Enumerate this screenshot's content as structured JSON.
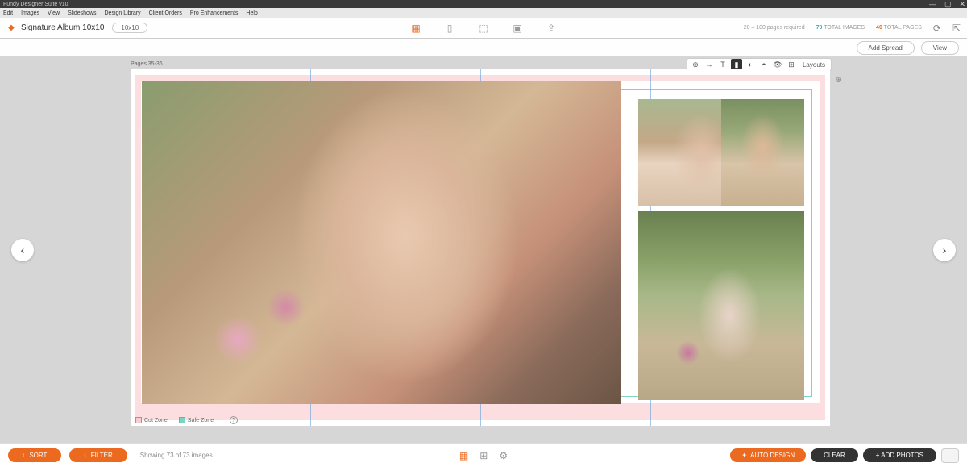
{
  "titlebar": {
    "app_name": "Fundy Designer Suite v10"
  },
  "window_controls": {
    "min": "—",
    "max": "▢",
    "close": "✕"
  },
  "menubar": {
    "items": [
      "Edit",
      "Images",
      "View",
      "Slideshows",
      "Design Library",
      "Client Orders",
      "Pro Enhancements",
      "Help"
    ]
  },
  "toolbar": {
    "album_title": "Signature Album 10x10",
    "size": "10x10",
    "pages_required": "~20 – 100 pages required",
    "total_images_count": "70",
    "total_images_label": "TOTAL IMAGES",
    "total_pages_count": "40",
    "total_pages_label": "TOTAL PAGES"
  },
  "subbar": {
    "add_spread": "Add Spread",
    "view": "View"
  },
  "workspace": {
    "pages_label": "Pages 35-36",
    "layouts_label": "Layouts",
    "legend_cut": "Cut Zone",
    "legend_safe": "Safe Zone"
  },
  "bottombar": {
    "sort": "SORT",
    "filter": "FILTER",
    "showing": "Showing 73 of 73 images",
    "auto_design": "AUTO DESIGN",
    "clear": "CLEAR",
    "add_photos": "+ ADD PHOTOS"
  }
}
